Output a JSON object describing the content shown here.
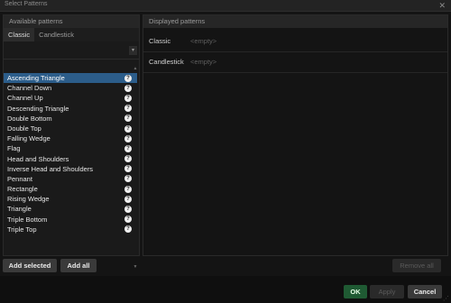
{
  "window": {
    "title": "Select Patterns",
    "close_glyph": "✕"
  },
  "available": {
    "header": "Available patterns",
    "tabs": [
      {
        "label": "Classic",
        "active": true
      },
      {
        "label": "Candlestick",
        "active": false
      }
    ],
    "items": [
      {
        "label": "Ascending Triangle",
        "selected": true
      },
      {
        "label": "Channel Down"
      },
      {
        "label": "Channel Up"
      },
      {
        "label": "Descending Triangle"
      },
      {
        "label": "Double Bottom"
      },
      {
        "label": "Double Top"
      },
      {
        "label": "Falling Wedge"
      },
      {
        "label": "Flag"
      },
      {
        "label": "Head and Shoulders"
      },
      {
        "label": "Inverse Head and Shoulders"
      },
      {
        "label": "Pennant"
      },
      {
        "label": "Rectangle"
      },
      {
        "label": "Rising Wedge"
      },
      {
        "label": "Triangle"
      },
      {
        "label": "Triple Bottom"
      },
      {
        "label": "Triple Top"
      }
    ],
    "help_glyph": "?",
    "dropdown_glyph": "▾"
  },
  "displayed": {
    "header": "Displayed patterns",
    "rows": [
      {
        "label": "Classic",
        "value": "<empty>"
      },
      {
        "label": "Candlestick",
        "value": "<empty>"
      }
    ]
  },
  "buttons": {
    "add_selected": "Add selected",
    "add_all": "Add all",
    "remove_all": "Remove all",
    "ok": "OK",
    "apply": "Apply",
    "cancel": "Cancel"
  },
  "colors": {
    "selection": "#2c5d8a",
    "ok_button": "#1f5a33",
    "background": "#141414"
  }
}
